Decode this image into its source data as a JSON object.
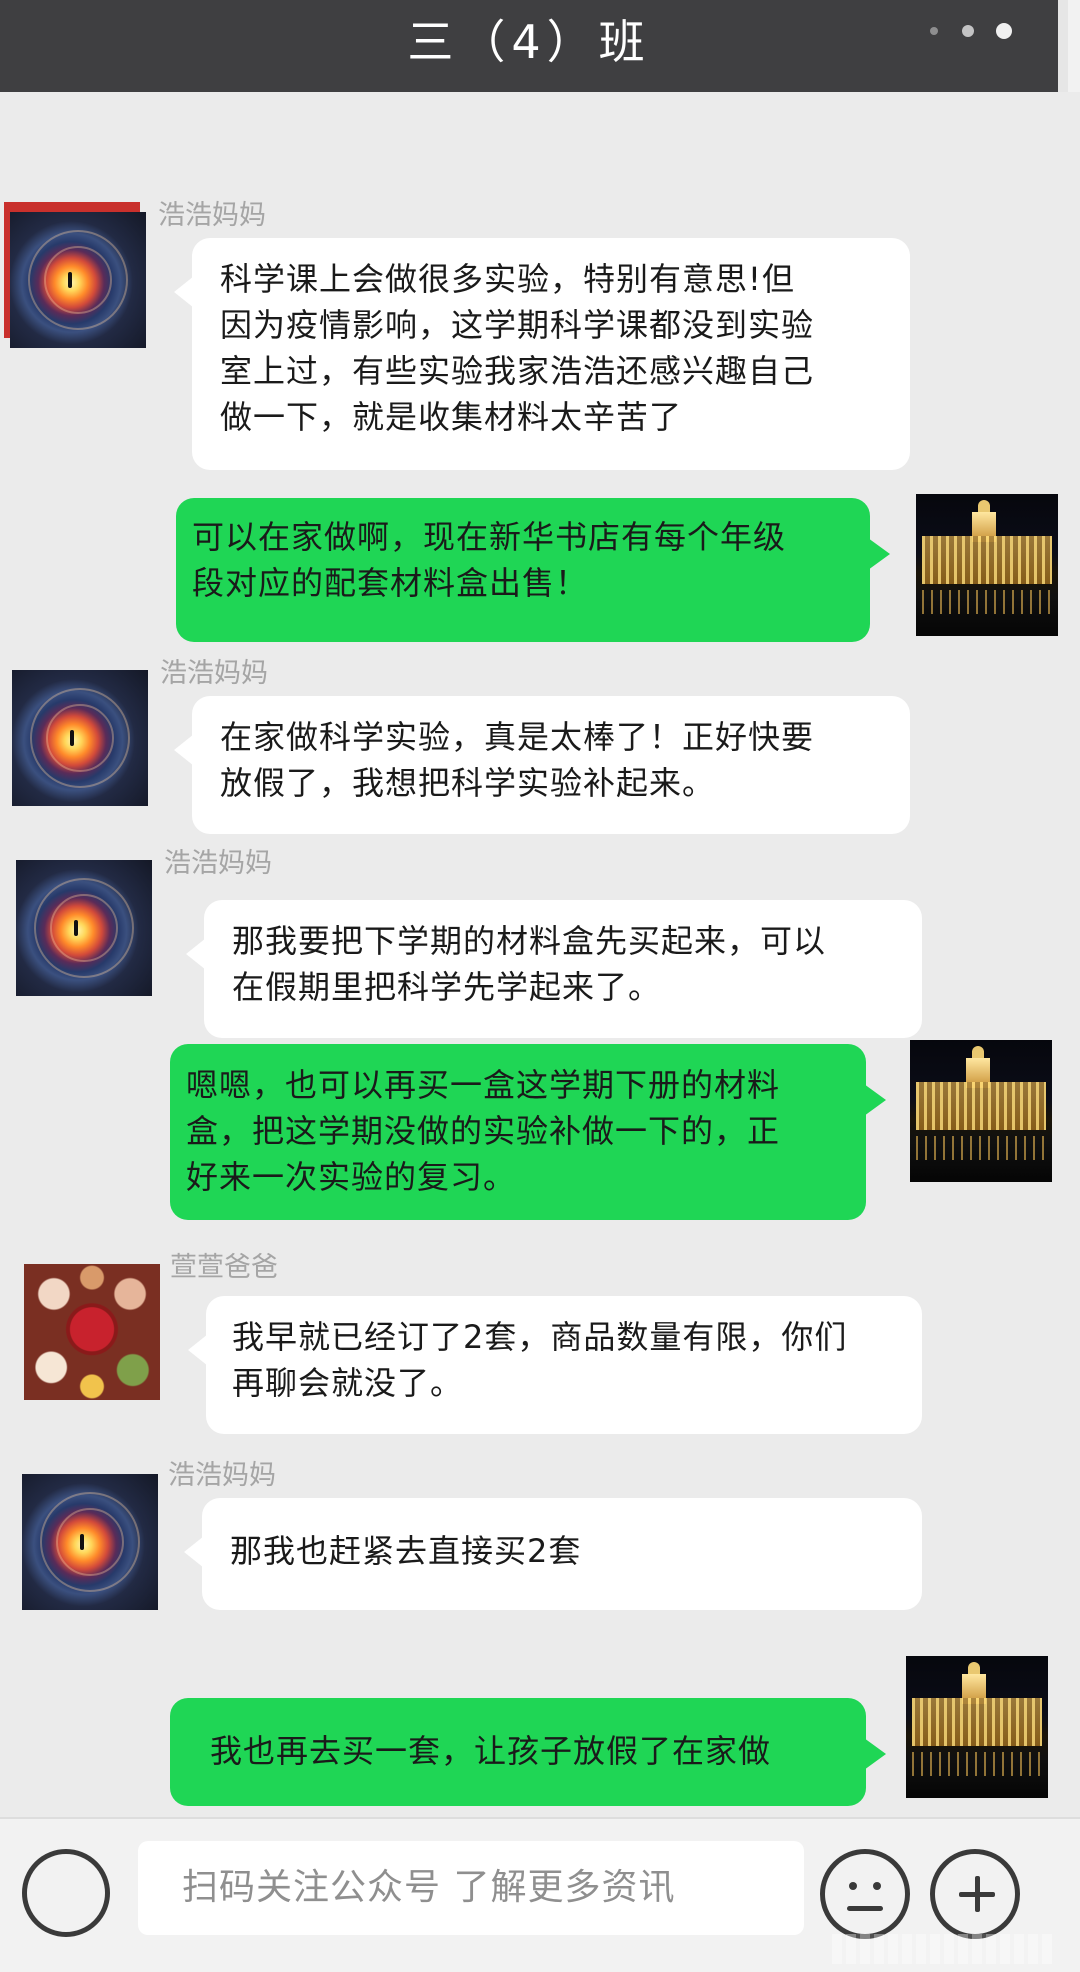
{
  "header": {
    "title": "三（4）班"
  },
  "messages": [
    {
      "sender": "浩浩妈妈",
      "text_lines": [
        "科学课上会做很多实验，特别有意思!但",
        "因为疫情影响，这学期科学课都没到实验",
        "室上过，有些实验我家浩浩还感兴趣自己",
        "做一下，就是收集材料太辛苦了"
      ]
    },
    {
      "sender": "",
      "text_lines": [
        "可以在家做啊，现在新华书店有每个年级",
        "段对应的配套材料盒出售！"
      ]
    },
    {
      "sender": "浩浩妈妈",
      "text_lines": [
        "在家做科学实验，真是太棒了！正好快要",
        "放假了，我想把科学实验补起来。"
      ]
    },
    {
      "sender": "浩浩妈妈",
      "text_lines": [
        "那我要把下学期的材料盒先买起来，可以",
        "在假期里把科学先学起来了。"
      ]
    },
    {
      "sender": "",
      "text_lines": [
        "嗯嗯，也可以再买一盒这学期下册的材料",
        "盒，把这学期没做的实验补做一下的，正",
        "好来一次实验的复习。"
      ]
    },
    {
      "sender": "萱萱爸爸",
      "text_lines": [
        "我早就已经订了2套，商品数量有限，你们",
        "再聊会就没了。"
      ]
    },
    {
      "sender": "浩浩妈妈",
      "text_lines": [
        "那我也赶紧去直接买2套"
      ]
    },
    {
      "sender": "",
      "text_lines": [
        "我也再去买一套，让孩子放假了在家做"
      ]
    }
  ],
  "input": {
    "placeholder": "扫码关注公众号 了解更多资讯"
  },
  "colors": {
    "header_bg": "#3f3f41",
    "chat_bg": "#ebebeb",
    "outgoing_bubble": "#1fd655",
    "incoming_bubble": "#ffffff",
    "sender_name": "#a5a5a5"
  },
  "icons": {
    "voice": "voice-circle-icon",
    "emoji": "emoji-face-icon",
    "plus": "plus-icon"
  }
}
